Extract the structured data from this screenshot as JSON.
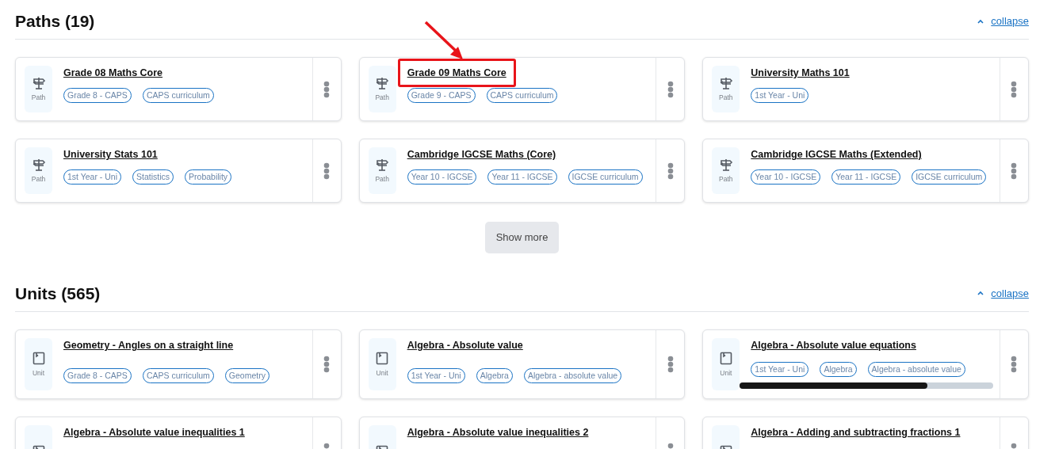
{
  "sections": [
    {
      "title": "Paths (19)",
      "collapse_label": "collapse",
      "show_more_label": "Show more",
      "items": [
        {
          "kind": "path",
          "type_label": "Path",
          "title": "Grade 08 Maths Core",
          "tags": [
            "Grade 8 - CAPS",
            "CAPS curriculum"
          ],
          "highlighted": false
        },
        {
          "kind": "path",
          "type_label": "Path",
          "title": "Grade 09 Maths Core",
          "tags": [
            "Grade 9 - CAPS",
            "CAPS curriculum"
          ],
          "highlighted": true
        },
        {
          "kind": "path",
          "type_label": "Path",
          "title": "University Maths 101",
          "tags": [
            "1st Year - Uni"
          ],
          "highlighted": false
        },
        {
          "kind": "path",
          "type_label": "Path",
          "title": "University Stats 101",
          "tags": [
            "1st Year - Uni",
            "Statistics",
            "Probability"
          ],
          "highlighted": false
        },
        {
          "kind": "path",
          "type_label": "Path",
          "title": "Cambridge IGCSE Maths (Core)",
          "tags": [
            "Year 10 - IGCSE",
            "Year 11 - IGCSE",
            "IGCSE curriculum"
          ],
          "highlighted": false
        },
        {
          "kind": "path",
          "type_label": "Path",
          "title": "Cambridge IGCSE Maths (Extended)",
          "tags": [
            "Year 10 - IGCSE",
            "Year 11 - IGCSE",
            "IGCSE curriculum"
          ],
          "highlighted": false
        }
      ]
    },
    {
      "title": "Units (565)",
      "collapse_label": "collapse",
      "items": [
        {
          "kind": "unit",
          "type_label": "Unit",
          "title": "Geometry - Angles on a straight line",
          "tags": [
            "Grade 8 - CAPS",
            "CAPS curriculum",
            "Geometry"
          ],
          "highlighted": false,
          "scrolls": false
        },
        {
          "kind": "unit",
          "type_label": "Unit",
          "title": "Algebra - Absolute value",
          "tags": [
            "1st Year - Uni",
            "Algebra",
            "Algebra - absolute value"
          ],
          "highlighted": false,
          "scrolls": false
        },
        {
          "kind": "unit",
          "type_label": "Unit",
          "title": "Algebra - Absolute value equations",
          "tags": [
            "1st Year - Uni",
            "Algebra",
            "Algebra - absolute value"
          ],
          "highlighted": false,
          "scrolls": true
        },
        {
          "kind": "unit",
          "title": "Algebra - Absolute value inequalities 1",
          "highlighted": false,
          "scrolls": false
        },
        {
          "kind": "unit",
          "title": "Algebra - Absolute value inequalities 2",
          "highlighted": false,
          "scrolls": false
        },
        {
          "kind": "unit",
          "title": "Algebra - Adding and subtracting fractions 1",
          "highlighted": false,
          "scrolls": false
        }
      ]
    }
  ]
}
